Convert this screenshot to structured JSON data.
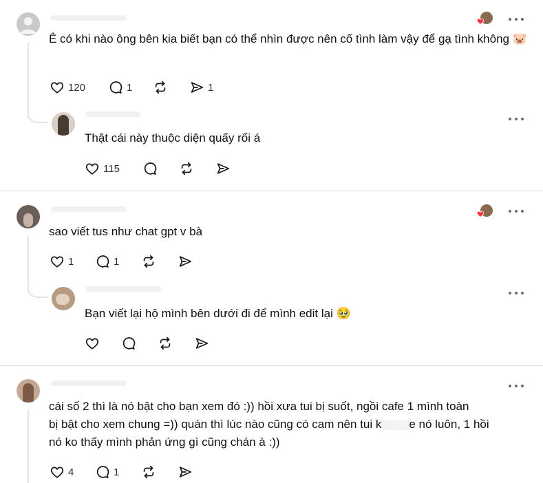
{
  "comments": [
    {
      "text": "Ê có khi nào ông bên kia biết bạn có thể nhìn được nên cố tình làm vậy để gạ tình không",
      "emoji": "🐷",
      "likes": "120",
      "replies": "1",
      "shares": "1"
    },
    {
      "text": "Thật cái này thuộc diện quấy rối á",
      "likes": "115"
    },
    {
      "text": "sao viết tus như chat gpt v bà",
      "likes": "1",
      "replies": "1"
    },
    {
      "text": "Bạn viết lại hộ mình bên dưới đi để mình edit lại",
      "emoji": "🥹"
    },
    {
      "text_lines": [
        "cái số 2 thì là nó bật cho bạn xem đó :)) hồi xưa tui bị suốt, ngồi cafe 1 mình toàn",
        "bị bật cho xem chung =)) quán thì lúc nào cũng có cam nên tui k",
        "e nó luôn, 1 hồi",
        "nó ko thấy mình phản ứng gì cũng chán à :))"
      ],
      "likes": "4",
      "replies": "1"
    }
  ],
  "colors": {
    "liked_heart": "#ff3040",
    "icon": "#1a1a1a",
    "divider": "#dcdcdc"
  }
}
